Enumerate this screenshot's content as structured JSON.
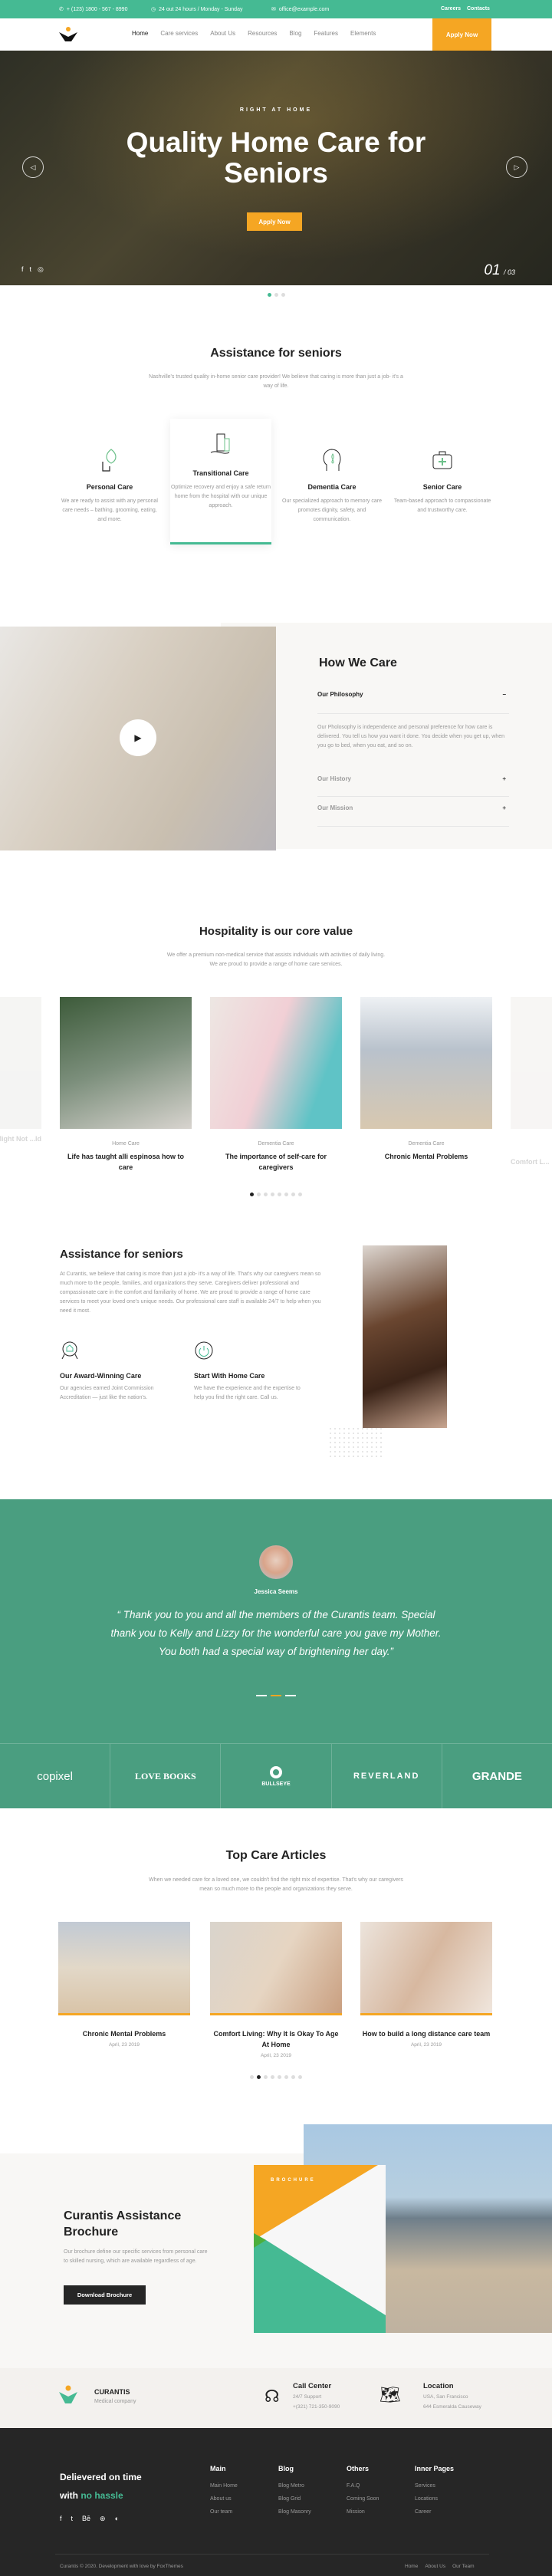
{
  "topbar": {
    "phone": "+ (123) 1800 - 567 - 8990",
    "hours": "24 out 24 hours / Monday - Sunday",
    "email": "office@example.com",
    "links": [
      "Careers",
      "Contacts"
    ]
  },
  "nav": {
    "items": [
      "Home",
      "Care services",
      "About Us",
      "Resources",
      "Blog",
      "Features",
      "Elements"
    ],
    "apply_label": "Apply Now"
  },
  "hero": {
    "eyebrow": "RIGHT AT HOME",
    "title": "Quality Home Care for Seniors",
    "button_label": "Apply Now",
    "slide_current": "01",
    "slide_total": "/ 03",
    "slides": 3,
    "active_slide": 1
  },
  "assistance": {
    "title": "Assistance for seniors",
    "intro": "Nashville's trusted quality in-home senior care provider! We believe that caring is more than just a job- it's a way of life.",
    "services": [
      {
        "icon": "hand-leaf-icon",
        "title": "Personal Care",
        "text": "We are ready to assist with any personal care needs – bathing, grooming, eating, and more."
      },
      {
        "icon": "hand-building-icon",
        "title": "Transitional Care",
        "text": "Optimize recovery and enjoy a safe return home from the hospital with our unique approach."
      },
      {
        "icon": "head-lotus-icon",
        "title": "Dementia Care",
        "text": "Our specialized approach to memory care promotes dignity, safety, and communication."
      },
      {
        "icon": "medical-bag-icon",
        "title": "Senior Care",
        "text": "Team-based approach to compassionate and trustworthy care."
      }
    ]
  },
  "how_we_care": {
    "title": "How We Care",
    "accordion": [
      {
        "title": "Our Philosophy",
        "open": true,
        "text": "Our Pholosophy is independence and personal preference for how care is delivered. You tell us how you want it done. You decide when you get up, when you go to bed, when you eat, and so on."
      },
      {
        "title": "Our History",
        "open": false
      },
      {
        "title": "Our Mission",
        "open": false
      }
    ]
  },
  "hospitality": {
    "title": "Hospitality is our core value",
    "intro_line1": "We offer a premium non-medical service that assists individuals with activities of daily living.",
    "intro_line2": "We are proud to provide a range of home care services.",
    "cards": [
      {
        "category": "",
        "title": "...Might Not ...ld"
      },
      {
        "category": "Home Care",
        "title": "Life has taught alli espinosa how to care"
      },
      {
        "category": "Dementia Care",
        "title": "The importance of self-care for caregivers"
      },
      {
        "category": "Dementia Care",
        "title": "Chronic Mental Problems"
      },
      {
        "category": "",
        "title": "Comfort L..."
      }
    ],
    "pages": 8,
    "active_page": 1
  },
  "assistance2": {
    "title": "Assistance for seniors",
    "text": "At Curantis, we believe that caring is more than just a job- it's a way of life. That's why our caregivers mean so much more to the people, families, and organizations they serve. Caregivers deliver professional and compassionate care in the comfort and familiarity of home. We are proud to provide a range of home care services to meet your loved one's unique needs. Our professional care staff is available 24/7 to help when you need it most.",
    "features": [
      {
        "icon": "award-badge-icon",
        "title": "Our Award-Winning Care",
        "text": "Our agencies earned Joint Commission Accreditation — just like the nation's."
      },
      {
        "icon": "power-icon",
        "title": "Start With Home Care",
        "text": "We have the experience and the expertise to help you find the right care. Call us."
      }
    ]
  },
  "testimonial": {
    "name": "Jessica Seems",
    "quote": "“ Thank you to you and all the members of the Curantis team. Special thank you to Kelly and Lizzy for the wonderful care you gave my Mother. You both had a special way of brightening her day.”",
    "logos": [
      "copixel",
      "LOVE BOOKS",
      "BULLSEYE",
      "REVERLAND",
      "GRANDE"
    ]
  },
  "articles": {
    "title": "Top Care Articles",
    "intro": "When we needed care for a loved one, we couldn't find the right mix of expertise. That's why our caregivers mean so much more to the people and organizations they serve.",
    "items": [
      {
        "title": "Chronic Mental Problems",
        "date": "April, 23 2019"
      },
      {
        "title": "Comfort Living: Why It Is Okay To Age At Home",
        "date": "April, 23 2019"
      },
      {
        "title": "How to build a long distance care team",
        "date": "April, 23 2019"
      }
    ],
    "pages": 8,
    "active_page": 2
  },
  "brochure": {
    "title": "Curantis Assistance Brochure",
    "text": "Our brochure define our specific services from personal care to skilled nursing, which are available regardless of age.",
    "button_label": "Download Brochure",
    "cover_label": "BROCHURE"
  },
  "info": {
    "brand": "CURANTIS",
    "tagline": "Medical company",
    "call_title": "Call Center",
    "call_line1": "24/7 Support",
    "call_line2": "+(321) 721-350-9090",
    "loc_title": "Location",
    "loc_line1": "USA, San Francisco",
    "loc_line2": "644 Esmeralda Causeway"
  },
  "footer": {
    "slogan_1": "Delievered on time",
    "slogan_2a": "with ",
    "slogan_2b": "no hassle",
    "columns": [
      {
        "title": "Main",
        "links": [
          "Main Home",
          "About us",
          "Our team"
        ]
      },
      {
        "title": "Blog",
        "links": [
          "Blog Metro",
          "Blog Grid",
          "Blog Masonry"
        ]
      },
      {
        "title": "Others",
        "links": [
          "F.A.Q",
          "Coming Soon",
          "Mission"
        ]
      },
      {
        "title": "Inner Pages",
        "links": [
          "Services",
          "Locations",
          "Career"
        ]
      }
    ],
    "copyright": "Curantis © 2020. Development with love by FoxThemes",
    "bottom_links": [
      "Home",
      "About Us",
      "Our Team"
    ]
  },
  "colors": {
    "accent": "#45ba93",
    "orange": "#f5a623",
    "dark": "#262626"
  }
}
